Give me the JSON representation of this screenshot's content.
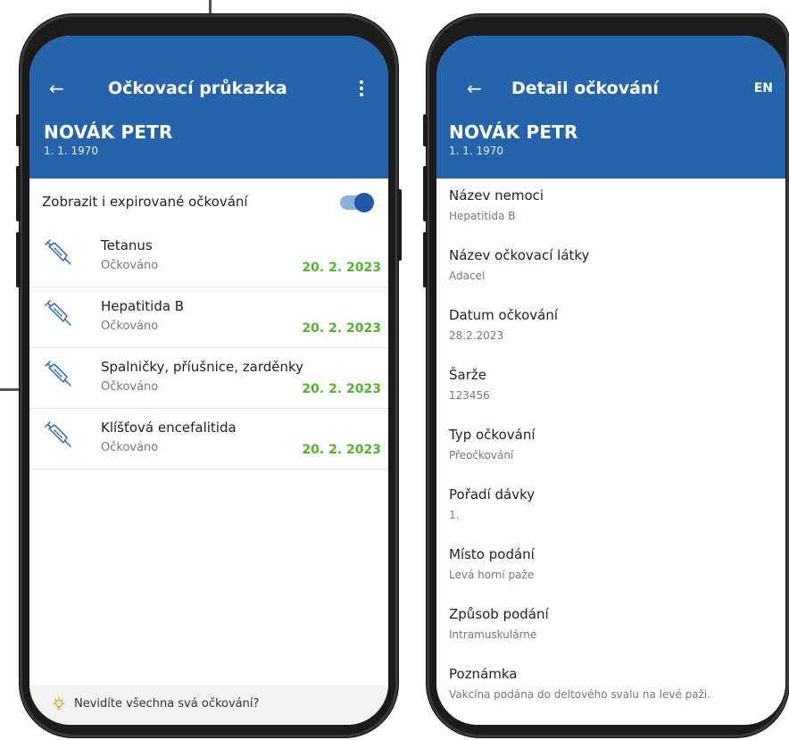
{
  "colors": {
    "header": "#2563ac",
    "date_green": "#53b32f",
    "toggle_on": "#1f5aa6"
  },
  "left_screen": {
    "title": "Očkovací průkazka",
    "back_icon": "arrow-left-icon",
    "menu_icon": "more-vertical-icon",
    "patient": {
      "name": "NOVÁK PETR",
      "dob": "1. 1. 1970"
    },
    "toggle": {
      "label": "Zobrazit i expirované očkování",
      "on": true
    },
    "items": [
      {
        "name": "Tetanus",
        "status": "Očkováno",
        "date": "20. 2. 2023",
        "icon": "syringe-icon"
      },
      {
        "name": "Hepatitida B",
        "status": "Očkováno",
        "date": "20. 2. 2023",
        "icon": "syringe-icon"
      },
      {
        "name": "Spalničky, příušnice, zarděnky",
        "status": "Očkováno",
        "date": "20. 2. 2023",
        "icon": "syringe-icon"
      },
      {
        "name": "Klíšťová encefalitida",
        "status": "Očkováno",
        "date": "20. 2. 2023",
        "icon": "syringe-icon"
      }
    ],
    "hint": {
      "icon": "lightbulb-icon",
      "text": "Nevidíte všechna svá očkování?"
    }
  },
  "right_screen": {
    "title": "Detail očkování",
    "back_icon": "arrow-left-icon",
    "lang": "EN",
    "patient": {
      "name": "NOVÁK PETR",
      "dob": "1. 1. 1970"
    },
    "fields": [
      {
        "label": "Název nemoci",
        "value": "Hepatitida B"
      },
      {
        "label": "Název očkovací látky",
        "value": "Adacel"
      },
      {
        "label": "Datum očkování",
        "value": "28.2.2023"
      },
      {
        "label": "Šarže",
        "value": "123456"
      },
      {
        "label": "Typ očkování",
        "value": "Přeočkování"
      },
      {
        "label": "Pořadí dávky",
        "value": "1."
      },
      {
        "label": "Místo podání",
        "value": "Levá horní paže"
      },
      {
        "label": "Způsob podání",
        "value": "Intramuskulárne"
      },
      {
        "label": "Poznámka",
        "value": "Vakcína podána do deltového svalu na levé paži."
      }
    ]
  }
}
